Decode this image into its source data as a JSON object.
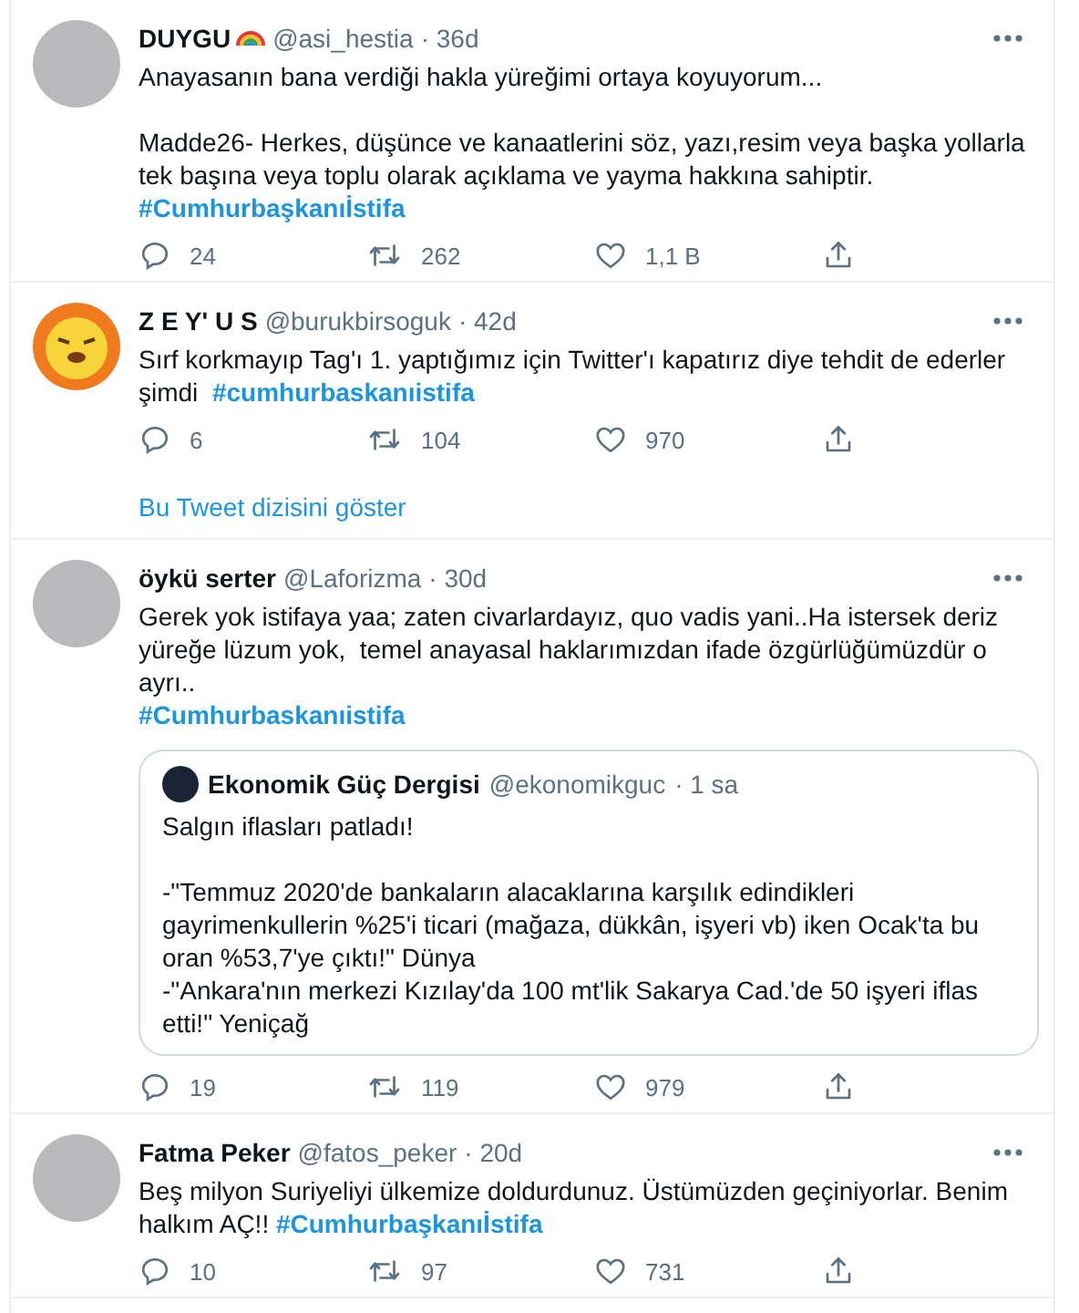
{
  "tweets": [
    {
      "avatar": {
        "kind": "photo"
      },
      "name": "DUYGU",
      "name_icon": {
        "kind": "rainbow"
      },
      "handle": "@asi_hestia",
      "time": "· 36d",
      "body": [
        {
          "kind": "text",
          "text": "Anayasanın bana verdiği hakla yüreğimi ortaya koyuyorum..."
        },
        {
          "kind": "break"
        },
        {
          "kind": "break"
        },
        {
          "kind": "text",
          "text": "Madde26- Herkes, düşünce ve kanaatlerini söz, yazı,resim veya başka yollarla"
        },
        {
          "kind": "break"
        },
        {
          "kind": "text",
          "text": "tek başına veya toplu olarak açıklama ve yayma hakkına sahiptir."
        },
        {
          "kind": "break"
        },
        {
          "kind": "hashtag",
          "text": "#Cumhurbaşkanıİstifa"
        }
      ],
      "replies": "24",
      "retweets": "262",
      "likes": "1,1 B"
    },
    {
      "avatar": {
        "kind": "cartoon"
      },
      "name": "Z E Y' U S",
      "handle": "@burukbirsoguk",
      "time": "· 42d",
      "body": [
        {
          "kind": "text",
          "text": "Sırf korkmayıp Tag'ı 1. yaptığımız için Twitter'ı kapatırız diye tehdit de ederler"
        },
        {
          "kind": "break"
        },
        {
          "kind": "text",
          "text": "şimdi  "
        },
        {
          "kind": "hashtag",
          "text": "#cumhurbaskanıistifa"
        }
      ],
      "replies": "6",
      "retweets": "104",
      "likes": "970",
      "thread_link": "Bu Tweet dizisini göster"
    },
    {
      "avatar": {
        "kind": "photo"
      },
      "name": "öykü serter",
      "handle": "@Laforizma",
      "time": "· 30d",
      "body": [
        {
          "kind": "text",
          "text": "Gerek yok istifaya yaa; zaten civarlardayız, quo vadis yani..Ha istersek deriz"
        },
        {
          "kind": "break"
        },
        {
          "kind": "text",
          "text": "yüreğe lüzum yok,  temel anayasal haklarımızdan ifade özgürlüğümüzdür o"
        },
        {
          "kind": "break"
        },
        {
          "kind": "text",
          "text": "ayrı.."
        },
        {
          "kind": "break"
        },
        {
          "kind": "hashtag",
          "text": "#Cumhurbaskanıistifa"
        }
      ],
      "quote": {
        "name": "Ekonomik Güç Dergisi",
        "handle": "@ekonomikguc",
        "time": "· 1 sa",
        "body": [
          {
            "kind": "text",
            "text": "Salgın iflasları patladı!"
          },
          {
            "kind": "break"
          },
          {
            "kind": "break"
          },
          {
            "kind": "text",
            "text": "-\"Temmuz 2020'de bankaların alacaklarına karşılık edindikleri"
          },
          {
            "kind": "break"
          },
          {
            "kind": "text",
            "text": "gayrimenkullerin %25'i ticari (mağaza, dükkân, işyeri vb) iken Ocak'ta bu"
          },
          {
            "kind": "break"
          },
          {
            "kind": "text",
            "text": "oran %53,7'ye çıktı!\" Dünya"
          },
          {
            "kind": "break"
          },
          {
            "kind": "text",
            "text": "-\"Ankara'nın merkezi Kızılay'da 100 mt'lik Sakarya Cad.'de 50 işyeri iflas"
          },
          {
            "kind": "break"
          },
          {
            "kind": "text",
            "text": "etti!\" Yeniçağ"
          }
        ]
      },
      "replies": "19",
      "retweets": "119",
      "likes": "979"
    },
    {
      "avatar": {
        "kind": "photo"
      },
      "name": "Fatma Peker",
      "handle": "@fatos_peker",
      "time": "· 20d",
      "body": [
        {
          "kind": "text",
          "text": "Beş milyon Suriyeliyi ülkemize doldurdunuz. Üstümüzden geçiniyorlar. Benim"
        },
        {
          "kind": "break"
        },
        {
          "kind": "text",
          "text": "halkım AÇ!! "
        },
        {
          "kind": "hashtag",
          "text": "#Cumhurbaşkanıİstifa"
        }
      ],
      "replies": "10",
      "retweets": "97",
      "likes": "731"
    }
  ]
}
